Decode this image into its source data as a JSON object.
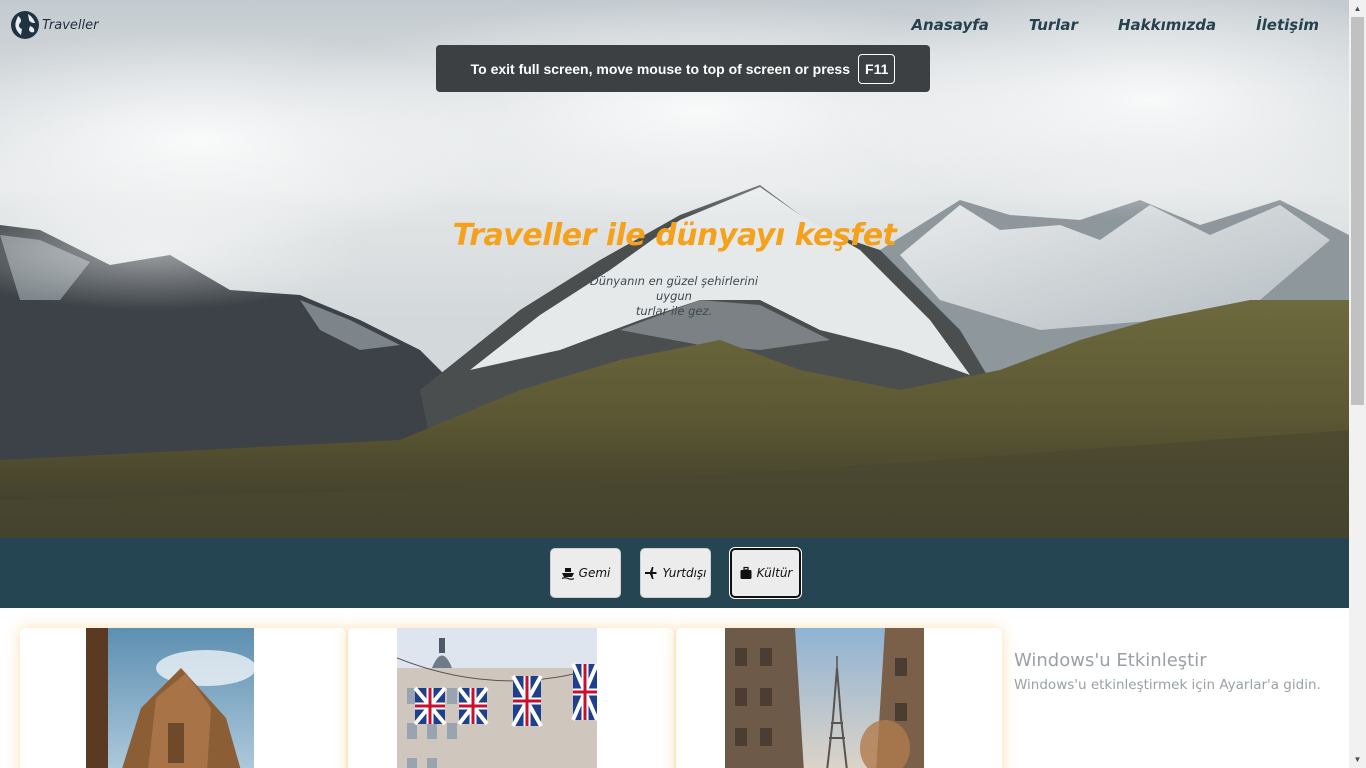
{
  "brand": {
    "name": "Traveller"
  },
  "nav": {
    "items": [
      "Anasayfa",
      "Turlar",
      "Hakkımızda",
      "İletişim"
    ]
  },
  "fullscreen_toast": {
    "message": "To exit full screen, move mouse to top of screen or press",
    "key": "F11"
  },
  "hero": {
    "title": "Traveller ile dünyayı keşfet",
    "subtitle_line1": "Dünyanın en güzel şehirlerini uygun",
    "subtitle_line2": "turlar ile gez."
  },
  "categories": [
    {
      "label": "Gemi",
      "icon": "ship-icon"
    },
    {
      "label": "Yurtdışı",
      "icon": "plane-icon"
    },
    {
      "label": "Kültür",
      "icon": "suitcase-icon",
      "active": true
    }
  ],
  "cards": [
    {
      "image": "ancient-temple-statue"
    },
    {
      "image": "london-flags-street"
    },
    {
      "image": "paris-eiffel-street"
    }
  ],
  "windows_watermark": {
    "title": "Windows'u Etkinleştir",
    "subtitle": "Windows'u etkinleştirmek için Ayarlar'a gidin."
  },
  "colors": {
    "accent": "#f5a11c",
    "nav_text": "#26414e",
    "category_bar": "#264552"
  }
}
